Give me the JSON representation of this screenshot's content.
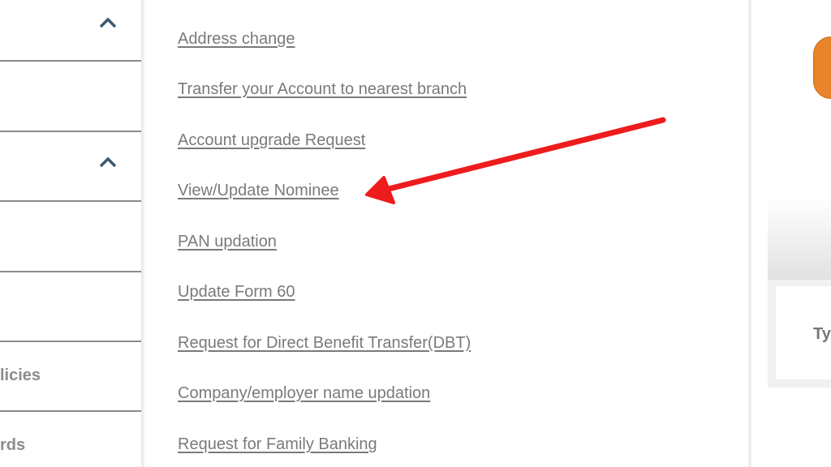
{
  "sidebar": {
    "partial_labels": [
      "licies",
      "rds"
    ],
    "chevron_icon": "chevron-up-icon",
    "chevron_color": "#3d5a6e"
  },
  "main": {
    "links": [
      "Address change",
      "Transfer your Account to nearest branch",
      "Account upgrade Request",
      "View/Update Nominee",
      "PAN updation",
      "Update Form 60",
      "Request for Direct Benefit Transfer(DBT)",
      "Company/employer name updation",
      "Request for Family Banking"
    ],
    "link_color": "#7a7a7a"
  },
  "annotation": {
    "arrow_color": "#ee1c1c",
    "points_to": "View/Update Nominee"
  },
  "right_panel": {
    "partial_text": "Ty",
    "button_color": "#e9842a"
  }
}
